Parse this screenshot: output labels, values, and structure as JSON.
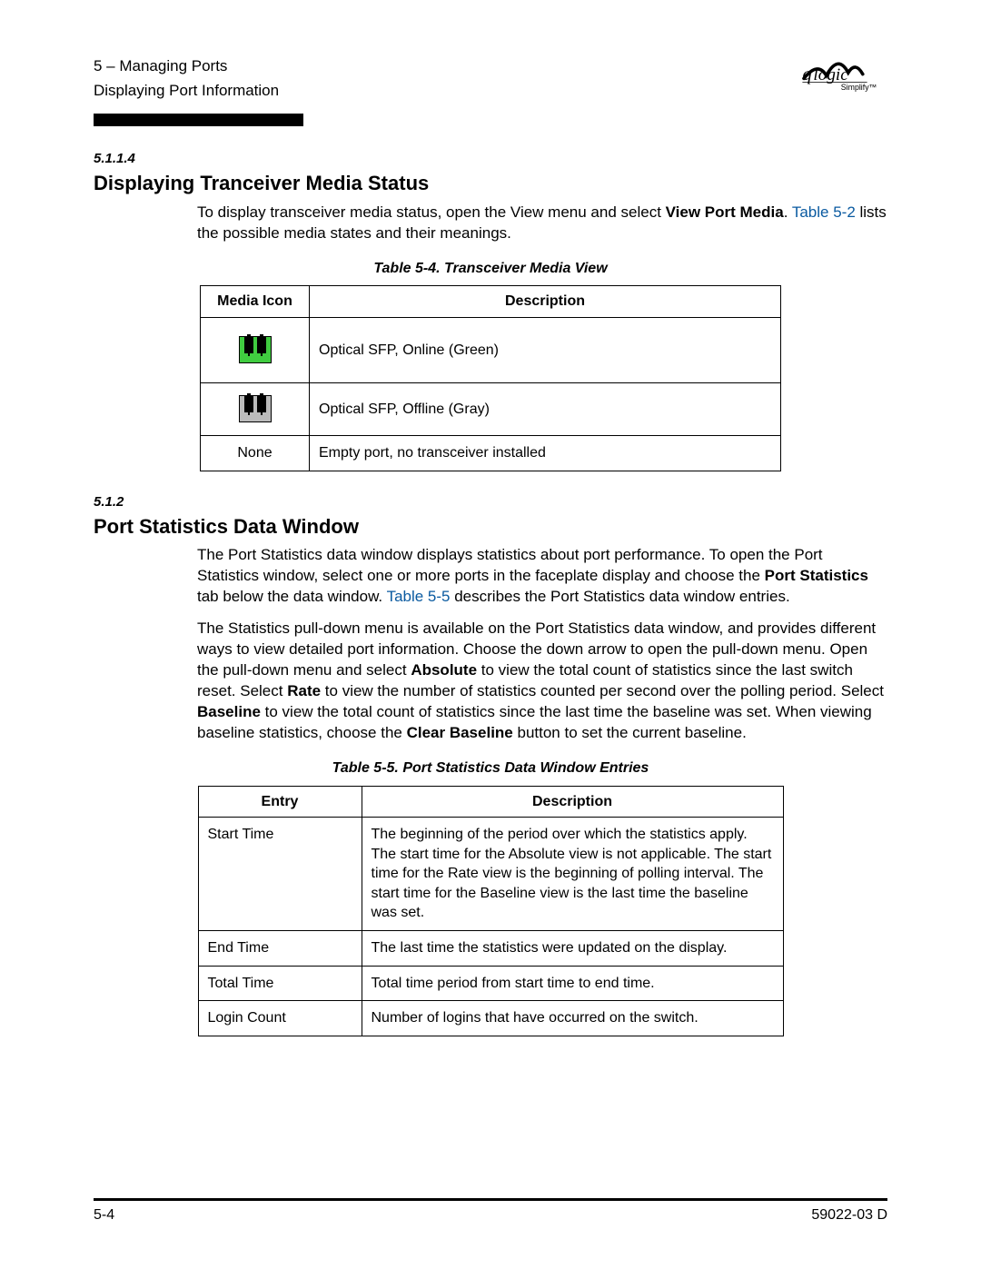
{
  "header": {
    "line1": "5 – Managing Ports",
    "line2": "Displaying Port Information"
  },
  "logo": {
    "brand": "qlogic",
    "tagline": "Simplify™"
  },
  "section1": {
    "number": "5.1.1.4",
    "title": "Displaying Tranceiver Media Status",
    "p1_a": "To display transceiver media status, open the View menu and select ",
    "p1_bold": "View Port Media",
    "p1_b": ". ",
    "p1_link": "Table 5-2",
    "p1_c": " lists the possible media states and their meanings."
  },
  "table1": {
    "caption": "Table 5-4. Transceiver Media View",
    "head": {
      "c1": "Media Icon",
      "c2": "Description"
    },
    "rows": [
      {
        "icon_hint": "green-sfp-icon",
        "desc": "Optical SFP, Online (Green)"
      },
      {
        "icon_hint": "gray-sfp-icon",
        "desc": "Optical SFP, Offline (Gray)"
      },
      {
        "icon_text": "None",
        "desc": "Empty port, no transceiver installed"
      }
    ]
  },
  "section2": {
    "number": "5.1.2",
    "title": "Port Statistics Data Window",
    "p1_a": "The Port Statistics data window displays statistics about port performance. To open the Port Statistics window, select one or more ports in the faceplate display and choose the ",
    "p1_bold1": "Port Statistics",
    "p1_b": " tab below the data window. ",
    "p1_link": "Table 5-5",
    "p1_c": " describes the Port Statistics data window entries.",
    "p2_a": "The Statistics pull-down menu is available on the Port Statistics data window, and provides different ways to view detailed port information. Choose the down arrow to open the pull-down menu. Open the pull-down menu and select ",
    "p2_b1": "Absolute",
    "p2_c": " to view the total count of statistics since the last switch reset. Select ",
    "p2_b2": "Rate",
    "p2_d": " to view the number of statistics counted per second over the polling period. Select ",
    "p2_b3": "Baseline",
    "p2_e": " to view the total count of statistics since the last time the baseline was set. When viewing baseline statistics, choose the ",
    "p2_b4": "Clear Baseline",
    "p2_f": " button to set the current baseline."
  },
  "table2": {
    "caption": "Table 5-5. Port Statistics Data Window Entries",
    "head": {
      "c1": "Entry",
      "c2": "Description"
    },
    "rows": [
      {
        "entry": "Start Time",
        "desc": "The beginning of the period over which the statistics apply. The start time for the Absolute view is not applicable. The start time for the Rate view is the beginning of polling interval. The start time for the Baseline view is the last time the baseline was set."
      },
      {
        "entry": "End Time",
        "desc": "The last time the statistics were updated on the display."
      },
      {
        "entry": "Total Time",
        "desc": "Total time period from start time to end time."
      },
      {
        "entry": "Login Count",
        "desc": "Number of logins that have occurred on the switch."
      }
    ]
  },
  "footer": {
    "left": "5-4",
    "right": "59022-03  D"
  }
}
